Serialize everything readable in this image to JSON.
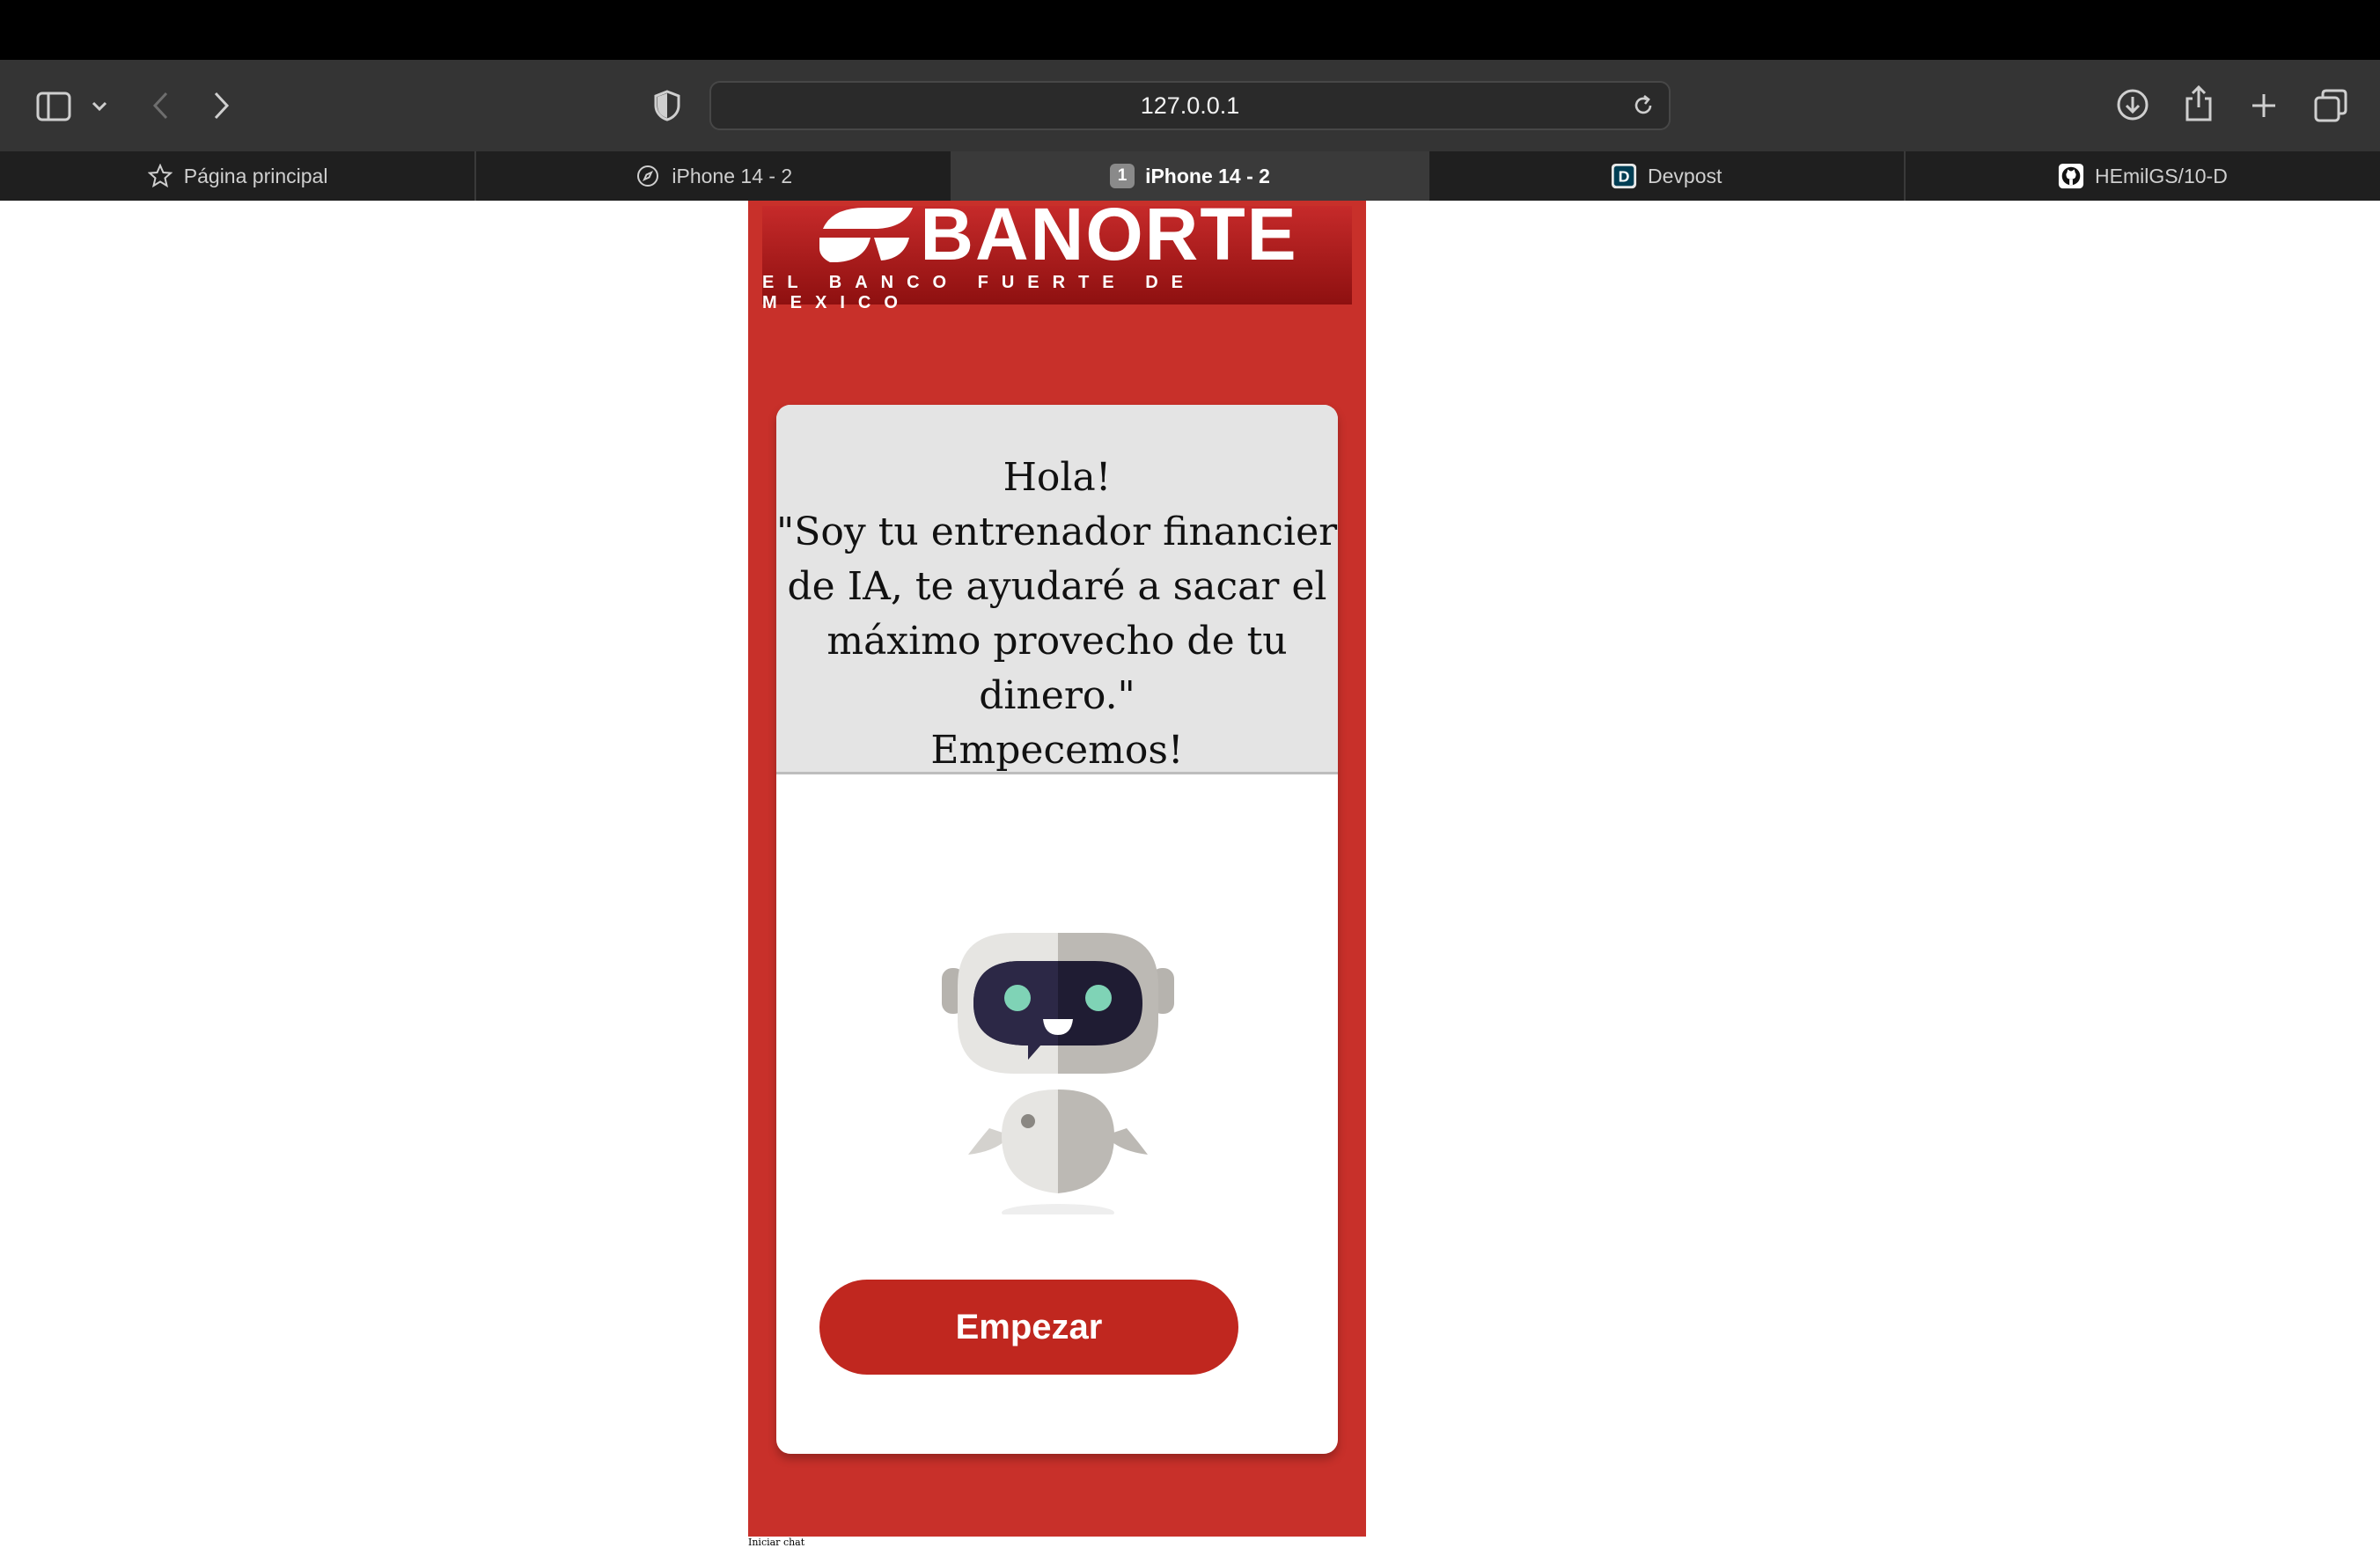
{
  "browser": {
    "address": "127.0.0.1",
    "tabs": [
      {
        "label": "Página principal",
        "icon": "star-icon",
        "active": false
      },
      {
        "label": "iPhone 14 - 2",
        "icon": "compass-icon",
        "active": false
      },
      {
        "label": "iPhone 14 - 2",
        "badge": "1",
        "active": true
      },
      {
        "label": "Devpost",
        "icon": "devpost-icon",
        "active": false
      },
      {
        "label": "HEmilGS/10-D",
        "icon": "github-icon",
        "active": false
      }
    ]
  },
  "brand": {
    "name": "BANORTE",
    "tagline": "EL BANCO FUERTE DE MEXICO",
    "color": "#c8302a"
  },
  "greeting": {
    "lines": [
      "Hola!",
      "\"Soy tu entrenador financiero",
      "de IA, te ayudaré a sacar el",
      "máximo provecho de tu",
      "dinero.\"",
      "Empecemos!"
    ]
  },
  "start_button": {
    "label": "Empezar"
  },
  "footer": {
    "text": "Iniciar chat"
  }
}
